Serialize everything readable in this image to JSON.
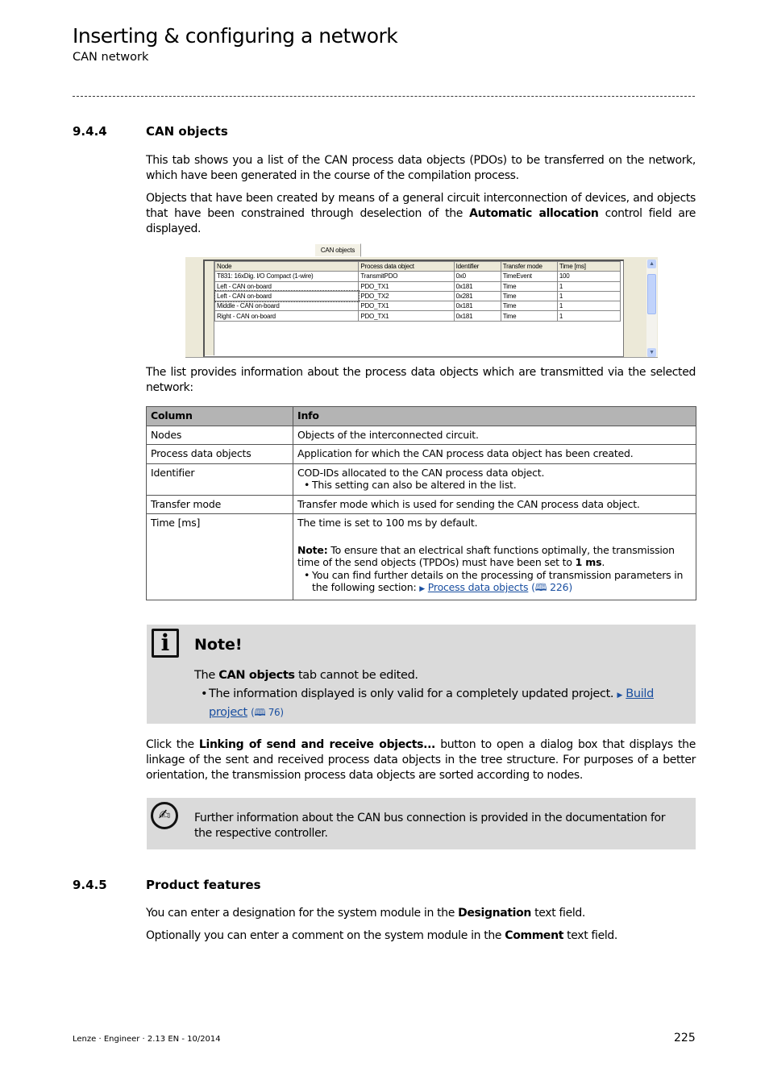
{
  "header": {
    "title": "Inserting & configuring a network",
    "subtitle": "CAN network"
  },
  "section1": {
    "number": "9.4.4",
    "title": "CAN objects",
    "para1": "This tab shows you a list of the CAN process data objects (PDOs) to be transferred on the network, which have been generated in the course of the compilation process.",
    "para2_a": "Objects that have been created by means of a general circuit interconnection of devices, and objects that have been constrained through deselection of the ",
    "para2_bold": "Automatic allocation",
    "para2_b": " control field are displayed.",
    "screenshot": {
      "tab": "CAN objects",
      "columns": [
        "Node",
        "Process data object",
        "Identifier",
        "Transfer mode",
        "Time [ms]"
      ],
      "rows": [
        [
          "T831: 16xDig. I/O Compact (1-wire)",
          "TransmitPDO",
          "0x0",
          "TimeEvent",
          "100"
        ],
        [
          "Left - CAN on-board",
          "PDO_TX1",
          "0x181",
          "Time",
          "1"
        ],
        [
          "Left - CAN on-board",
          "PDO_TX2",
          "0x281",
          "Time",
          "1"
        ],
        [
          "Middle - CAN on-board",
          "PDO_TX1",
          "0x181",
          "Time",
          "1"
        ],
        [
          "Right - CAN on-board",
          "PDO_TX1",
          "0x181",
          "Time",
          "1"
        ]
      ],
      "selected_row": 2
    },
    "para3": "The list provides information about the process data objects which are transmitted via the selected network:",
    "table": {
      "headers": [
        "Column",
        "Info"
      ],
      "rows": [
        {
          "col": "Nodes",
          "info": "Objects of the interconnected circuit."
        },
        {
          "col": "Process data objects",
          "info": "Application for which the CAN process data object has been created."
        },
        {
          "col": "Identifier",
          "info": "COD-IDs allocated to the CAN process data object.",
          "bullet": "This setting can also be altered in the list."
        },
        {
          "col": "Transfer mode",
          "info": "Transfer mode which is used for sending the CAN process data object."
        },
        {
          "col": "Time [ms]",
          "info": "The time is set to 100 ms by default.",
          "note_label": "Note:",
          "note_text": " To ensure that an electrical shaft functions optimally, the transmission time of the send objects (TPDOs) must have been set to ",
          "note_bold": "1 ms",
          "note_end": ".",
          "bullet": "You can find further details on the processing of transmission parameters in the following section: ",
          "link": "Process data objects",
          "ref": "(🕮 226)"
        }
      ]
    },
    "note": {
      "title": "Note!",
      "line_a": "The ",
      "line_bold": "CAN objects",
      "line_b": " tab cannot be edited.",
      "bullet": "The information displayed is only valid for a completely updated project. ",
      "link": "Build project",
      "ref": "(🕮 76)"
    },
    "para4_a": "Click the ",
    "para4_bold": "Linking of send and receive objects...",
    "para4_b": " button to open a dialog box that displays the linkage of the sent and received process data objects in the tree structure. For purposes of a better orientation, the transmission process data objects are sorted according to nodes.",
    "hint": "Further information about the CAN bus connection is provided in the documentation for the respective controller."
  },
  "section2": {
    "number": "9.4.5",
    "title": "Product features",
    "para1_a": "You can enter a designation for the system module in the ",
    "para1_bold": "Designation",
    "para1_b": " text field.",
    "para2_a": "Optionally you can enter a comment on the system module in the ",
    "para2_bold": "Comment",
    "para2_b": " text field."
  },
  "footer": {
    "text": "Lenze · Engineer · 2.13 EN - 10/2014",
    "page": "225"
  }
}
